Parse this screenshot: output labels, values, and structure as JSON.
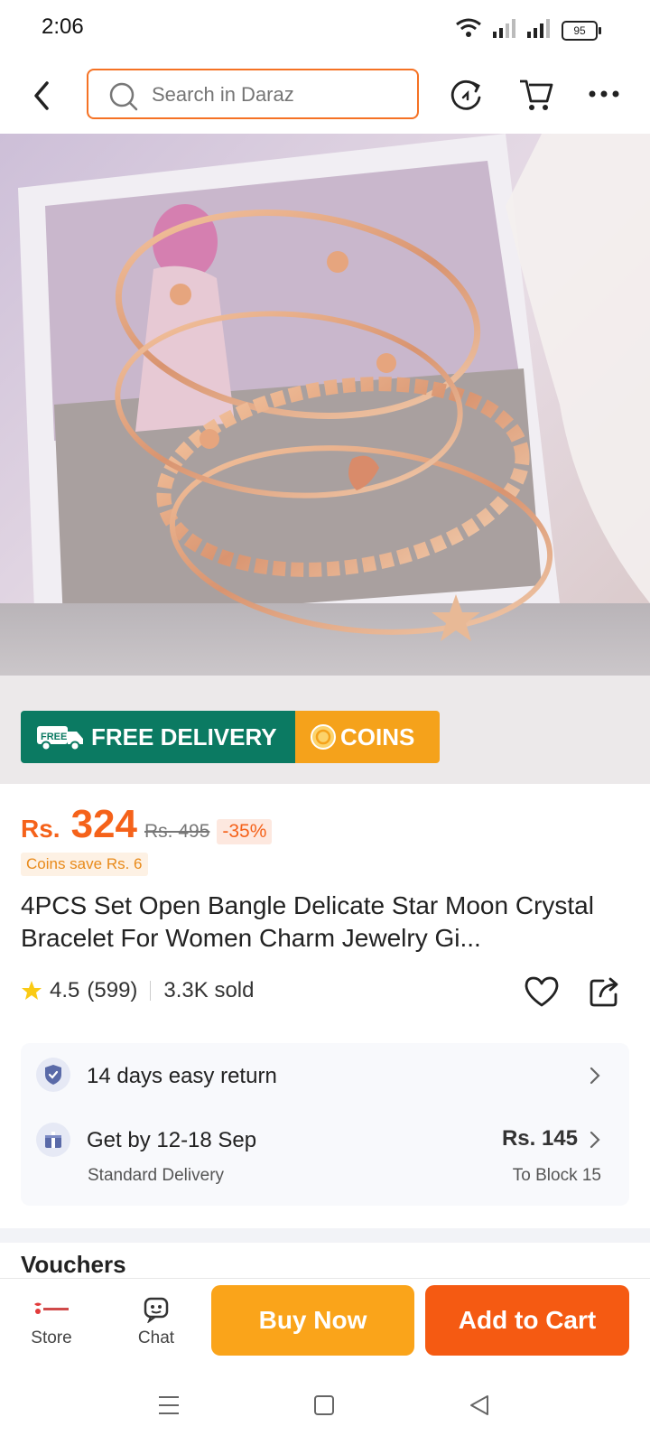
{
  "status_bar": {
    "time": "2:06",
    "battery": "95"
  },
  "header": {
    "search_placeholder": "Search in Daraz"
  },
  "badges": {
    "free_delivery": "FREE DELIVERY",
    "free_tag": "FREE",
    "coins": "COINS"
  },
  "product": {
    "currency": "Rs.",
    "price": "324",
    "original_price": "Rs. 495",
    "discount": "-35%",
    "coins_save": "Coins save Rs. 6",
    "title": "4PCS Set Open Bangle Delicate Star Moon Crystal Bracelet For Women Charm Jewelry Gi...",
    "rating": "4.5",
    "reviews": "(599)",
    "sold": "3.3K sold"
  },
  "services": {
    "return_text": "14 days easy return",
    "delivery_title": "Get by 12-18 Sep",
    "delivery_type": "Standard Delivery",
    "delivery_price": "Rs. 145",
    "delivery_location": "To Block 15"
  },
  "section_peek": "Vouchers",
  "bottom_bar": {
    "store_label": "Store",
    "chat_label": "Chat",
    "buy_now": "Buy Now",
    "add_to_cart": "Add to Cart"
  },
  "colors": {
    "accent": "#f57224",
    "price": "#f5621a",
    "buy_now": "#faa41a",
    "add_to_cart": "#f55a12",
    "free_delivery_bg": "#0b7a62",
    "coins_bg": "#f5a21b"
  }
}
